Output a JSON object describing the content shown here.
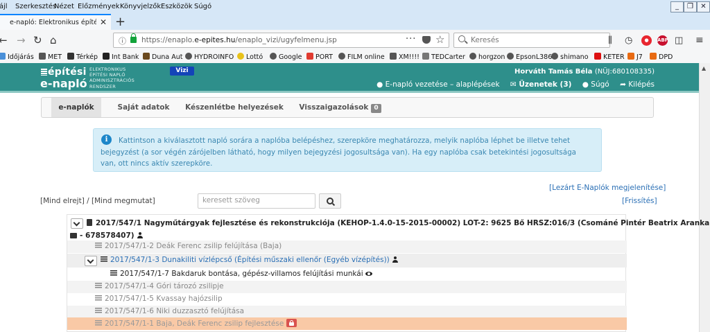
{
  "browser": {
    "menu": [
      "Fájl",
      "Szerkesztés",
      "Nézet",
      "Előzmények",
      "Könyvjelzők",
      "Eszközök",
      "Súgó"
    ],
    "tab_title": "e-napló: Elektronikus építési napló",
    "url_prefix": "https://enaplo.",
    "url_domain": "e-epites.hu",
    "url_path": "/enaplo_vizi/ugyfelmenu.jsp",
    "search_placeholder": "Keresés",
    "bookmarks": [
      "Időjárás",
      "MET",
      "Térkép",
      "Int Bank",
      "Duna Aut",
      "HYDROINFO",
      "Lottó",
      "Google",
      "PORT",
      "FILM online",
      "XM!!!!",
      "TEDCarter",
      "horgzon",
      "EpsonL386",
      "shimano",
      "KETER",
      "J7",
      "DPD"
    ]
  },
  "app": {
    "logo_line1": "építési",
    "logo_line2": "e-napló",
    "logo_sub": [
      "ELEKTRONIKUS",
      "ÉPÍTÉSI NAPLÓ",
      "ADMINISZTRÁCIÓS",
      "RENDSZER"
    ],
    "module_badge": "Vizi",
    "user_name": "Horváth Tamás Béla",
    "user_id": "(NÜJ:680108335)",
    "header_menu": {
      "guide": "E-napló vezetése – alaplépések",
      "messages": "Üzenetek (3)",
      "help": "Súgó",
      "logout": "Kilépés"
    }
  },
  "tabs": {
    "enaplok": "e-naplók",
    "sajat": "Saját adatok",
    "keszenletbe": "Készenlétbe helyezések",
    "visszaigazolasok": "Visszaigazolások",
    "visszaigazolasok_count": "0"
  },
  "info_text": "Kattintson a kiválasztott napló sorára a naplóba belépéshez, szerepköre meghatározza, melyik naplóba léphet be illetve tehet bejegyzést (a sor végén zárójelben látható, hogy milyen bejegyzési jogosultsága van). Ha egy naplóba csak betekintési jogosultsága van, ott nincs aktív szerepköre.",
  "links": {
    "lezart": "[Lezárt E-Naplók megjelenítése]",
    "mind_elrejt": "[Mind elrejt]",
    "separator": " / ",
    "mind_megmutat": "[Mind megmutat]",
    "frissites": "[Frissítés]"
  },
  "search": {
    "placeholder": "keresett szöveg"
  },
  "tree": {
    "root_line1": "2017/547/1 Nagyműtárgyak fejlesztése és rekonstrukciója (KEHOP-1.4.0-15-2015-00002) LOT-2: 9625 Bő HRSZ:016/3 (Csománé Pintér Beatrix Aranka",
    "root_line2": "- 678578407)",
    "items": [
      "2017/547/1-2 Deák Ferenc zsilip felújítása (Baja)",
      "2017/547/1-3 Dunakiliti vízlépcső (Építési műszaki ellenőr (Egyéb vízépítés))",
      "2017/547/1-7 Bakdaruk bontása, gépész-villamos felújítási munkái",
      "2017/547/1-4 Góri tározó zsilipje",
      "2017/547/1-5 Kvassay hajózsilip",
      "2017/547/1-6 Niki duzzasztó felújítása",
      "2017/547/1-1 Baja, Deák Ferenc zsilip fejlesztése"
    ]
  },
  "colors": {
    "header_teal": "#2e8f8b",
    "vizi_blue": "#1444b8",
    "info_bg": "#d7eef8",
    "highlight_row": "#f9c9a6",
    "lock_red": "#d9534f"
  }
}
